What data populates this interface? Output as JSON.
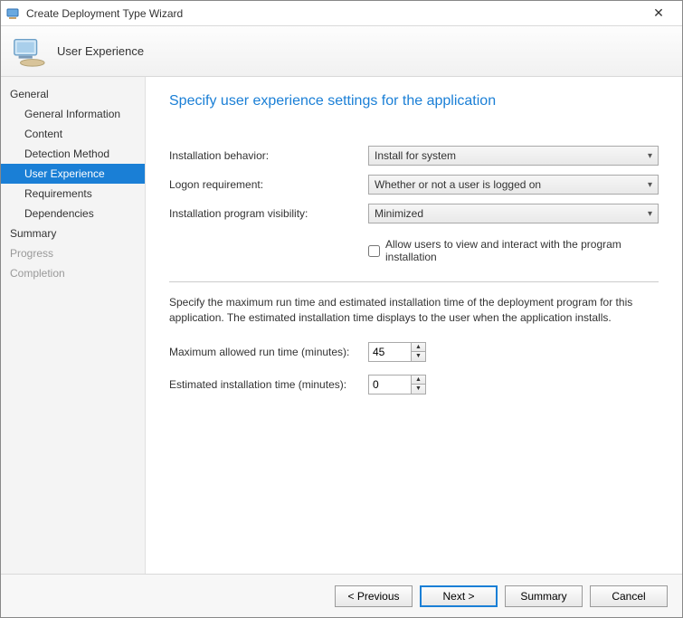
{
  "window": {
    "title": "Create Deployment Type Wizard"
  },
  "header": {
    "page_name": "User Experience"
  },
  "sidebar": {
    "group_general": "General",
    "steps": {
      "general_info": "General Information",
      "content": "Content",
      "detection": "Detection Method",
      "user_experience": "User Experience",
      "requirements": "Requirements",
      "dependencies": "Dependencies"
    },
    "group_summary": "Summary",
    "group_progress": "Progress",
    "group_completion": "Completion"
  },
  "main": {
    "heading": "Specify user experience settings for the application",
    "install_behavior_label": "Installation behavior:",
    "install_behavior_value": "Install for system",
    "logon_req_label": "Logon requirement:",
    "logon_req_value": "Whether or not a user is logged on",
    "visibility_label": "Installation program visibility:",
    "visibility_value": "Minimized",
    "allow_interact_label": "Allow users to view and interact with the program installation",
    "description": "Specify the maximum run time and estimated installation time of the deployment program for this application. The estimated installation time displays to the user when the application installs.",
    "max_runtime_label": "Maximum allowed run time (minutes):",
    "max_runtime_value": "45",
    "est_time_label": "Estimated installation time (minutes):",
    "est_time_value": "0"
  },
  "footer": {
    "previous": "< Previous",
    "next": "Next >",
    "summary": "Summary",
    "cancel": "Cancel"
  }
}
